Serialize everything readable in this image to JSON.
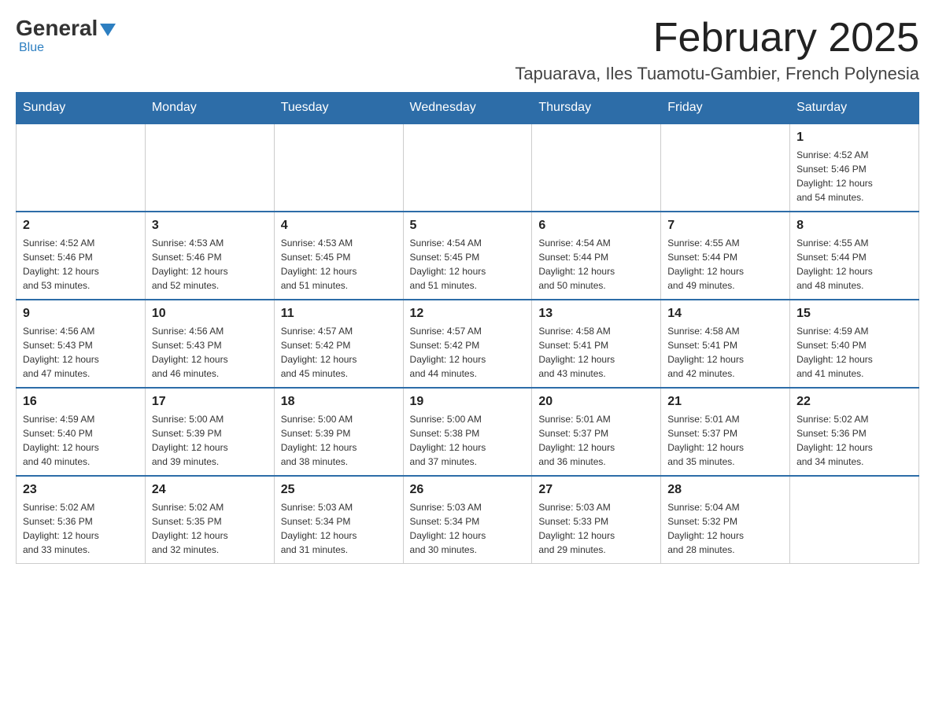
{
  "header": {
    "logo": {
      "general": "General",
      "blue": "Blue"
    },
    "title": "February 2025",
    "location": "Tapuarava, Iles Tuamotu-Gambier, French Polynesia"
  },
  "days_of_week": [
    "Sunday",
    "Monday",
    "Tuesday",
    "Wednesday",
    "Thursday",
    "Friday",
    "Saturday"
  ],
  "weeks": [
    {
      "days": [
        {
          "num": "",
          "info": ""
        },
        {
          "num": "",
          "info": ""
        },
        {
          "num": "",
          "info": ""
        },
        {
          "num": "",
          "info": ""
        },
        {
          "num": "",
          "info": ""
        },
        {
          "num": "",
          "info": ""
        },
        {
          "num": "1",
          "info": "Sunrise: 4:52 AM\nSunset: 5:46 PM\nDaylight: 12 hours\nand 54 minutes."
        }
      ]
    },
    {
      "days": [
        {
          "num": "2",
          "info": "Sunrise: 4:52 AM\nSunset: 5:46 PM\nDaylight: 12 hours\nand 53 minutes."
        },
        {
          "num": "3",
          "info": "Sunrise: 4:53 AM\nSunset: 5:46 PM\nDaylight: 12 hours\nand 52 minutes."
        },
        {
          "num": "4",
          "info": "Sunrise: 4:53 AM\nSunset: 5:45 PM\nDaylight: 12 hours\nand 51 minutes."
        },
        {
          "num": "5",
          "info": "Sunrise: 4:54 AM\nSunset: 5:45 PM\nDaylight: 12 hours\nand 51 minutes."
        },
        {
          "num": "6",
          "info": "Sunrise: 4:54 AM\nSunset: 5:44 PM\nDaylight: 12 hours\nand 50 minutes."
        },
        {
          "num": "7",
          "info": "Sunrise: 4:55 AM\nSunset: 5:44 PM\nDaylight: 12 hours\nand 49 minutes."
        },
        {
          "num": "8",
          "info": "Sunrise: 4:55 AM\nSunset: 5:44 PM\nDaylight: 12 hours\nand 48 minutes."
        }
      ]
    },
    {
      "days": [
        {
          "num": "9",
          "info": "Sunrise: 4:56 AM\nSunset: 5:43 PM\nDaylight: 12 hours\nand 47 minutes."
        },
        {
          "num": "10",
          "info": "Sunrise: 4:56 AM\nSunset: 5:43 PM\nDaylight: 12 hours\nand 46 minutes."
        },
        {
          "num": "11",
          "info": "Sunrise: 4:57 AM\nSunset: 5:42 PM\nDaylight: 12 hours\nand 45 minutes."
        },
        {
          "num": "12",
          "info": "Sunrise: 4:57 AM\nSunset: 5:42 PM\nDaylight: 12 hours\nand 44 minutes."
        },
        {
          "num": "13",
          "info": "Sunrise: 4:58 AM\nSunset: 5:41 PM\nDaylight: 12 hours\nand 43 minutes."
        },
        {
          "num": "14",
          "info": "Sunrise: 4:58 AM\nSunset: 5:41 PM\nDaylight: 12 hours\nand 42 minutes."
        },
        {
          "num": "15",
          "info": "Sunrise: 4:59 AM\nSunset: 5:40 PM\nDaylight: 12 hours\nand 41 minutes."
        }
      ]
    },
    {
      "days": [
        {
          "num": "16",
          "info": "Sunrise: 4:59 AM\nSunset: 5:40 PM\nDaylight: 12 hours\nand 40 minutes."
        },
        {
          "num": "17",
          "info": "Sunrise: 5:00 AM\nSunset: 5:39 PM\nDaylight: 12 hours\nand 39 minutes."
        },
        {
          "num": "18",
          "info": "Sunrise: 5:00 AM\nSunset: 5:39 PM\nDaylight: 12 hours\nand 38 minutes."
        },
        {
          "num": "19",
          "info": "Sunrise: 5:00 AM\nSunset: 5:38 PM\nDaylight: 12 hours\nand 37 minutes."
        },
        {
          "num": "20",
          "info": "Sunrise: 5:01 AM\nSunset: 5:37 PM\nDaylight: 12 hours\nand 36 minutes."
        },
        {
          "num": "21",
          "info": "Sunrise: 5:01 AM\nSunset: 5:37 PM\nDaylight: 12 hours\nand 35 minutes."
        },
        {
          "num": "22",
          "info": "Sunrise: 5:02 AM\nSunset: 5:36 PM\nDaylight: 12 hours\nand 34 minutes."
        }
      ]
    },
    {
      "days": [
        {
          "num": "23",
          "info": "Sunrise: 5:02 AM\nSunset: 5:36 PM\nDaylight: 12 hours\nand 33 minutes."
        },
        {
          "num": "24",
          "info": "Sunrise: 5:02 AM\nSunset: 5:35 PM\nDaylight: 12 hours\nand 32 minutes."
        },
        {
          "num": "25",
          "info": "Sunrise: 5:03 AM\nSunset: 5:34 PM\nDaylight: 12 hours\nand 31 minutes."
        },
        {
          "num": "26",
          "info": "Sunrise: 5:03 AM\nSunset: 5:34 PM\nDaylight: 12 hours\nand 30 minutes."
        },
        {
          "num": "27",
          "info": "Sunrise: 5:03 AM\nSunset: 5:33 PM\nDaylight: 12 hours\nand 29 minutes."
        },
        {
          "num": "28",
          "info": "Sunrise: 5:04 AM\nSunset: 5:32 PM\nDaylight: 12 hours\nand 28 minutes."
        },
        {
          "num": "",
          "info": ""
        }
      ]
    }
  ]
}
